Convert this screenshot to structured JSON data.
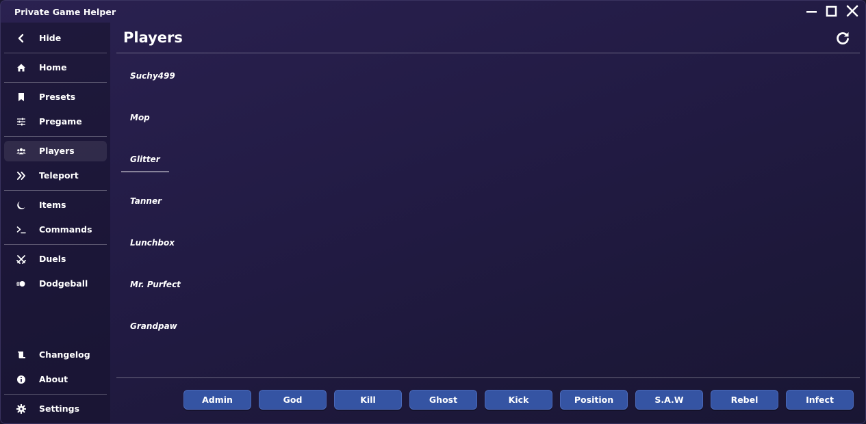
{
  "window": {
    "title": "Private Game Helper"
  },
  "sidebar": {
    "items": [
      {
        "label": "Hide",
        "icon": "chevron-left-icon"
      },
      {
        "label": "Home",
        "icon": "home-icon"
      },
      {
        "label": "Presets",
        "icon": "bookmark-icon"
      },
      {
        "label": "Pregame",
        "icon": "sliders-icon"
      },
      {
        "label": "Players",
        "icon": "users-icon",
        "active": true
      },
      {
        "label": "Teleport",
        "icon": "double-chevron-right-icon"
      },
      {
        "label": "Items",
        "icon": "moon-icon"
      },
      {
        "label": "Commands",
        "icon": "terminal-icon"
      },
      {
        "label": "Duels",
        "icon": "crossed-swords-icon"
      },
      {
        "label": "Dodgeball",
        "icon": "ball-icon"
      },
      {
        "label": "Changelog",
        "icon": "scroll-icon"
      },
      {
        "label": "About",
        "icon": "info-icon"
      },
      {
        "label": "Settings",
        "icon": "gear-icon"
      }
    ]
  },
  "main": {
    "title": "Players",
    "players": [
      "Suchy499",
      "Mop",
      "Glitter",
      "Tanner",
      "Lunchbox",
      "Mr. Purfect",
      "Grandpaw"
    ],
    "selected_player": "Glitter",
    "actions": [
      "Admin",
      "God",
      "Kill",
      "Ghost",
      "Kick",
      "Position",
      "S.A.W",
      "Rebel",
      "Infect"
    ]
  },
  "colors": {
    "button_bg": "#3554a3",
    "background": "#221b44",
    "active_nav": "rgba(255,255,255,0.09)"
  }
}
